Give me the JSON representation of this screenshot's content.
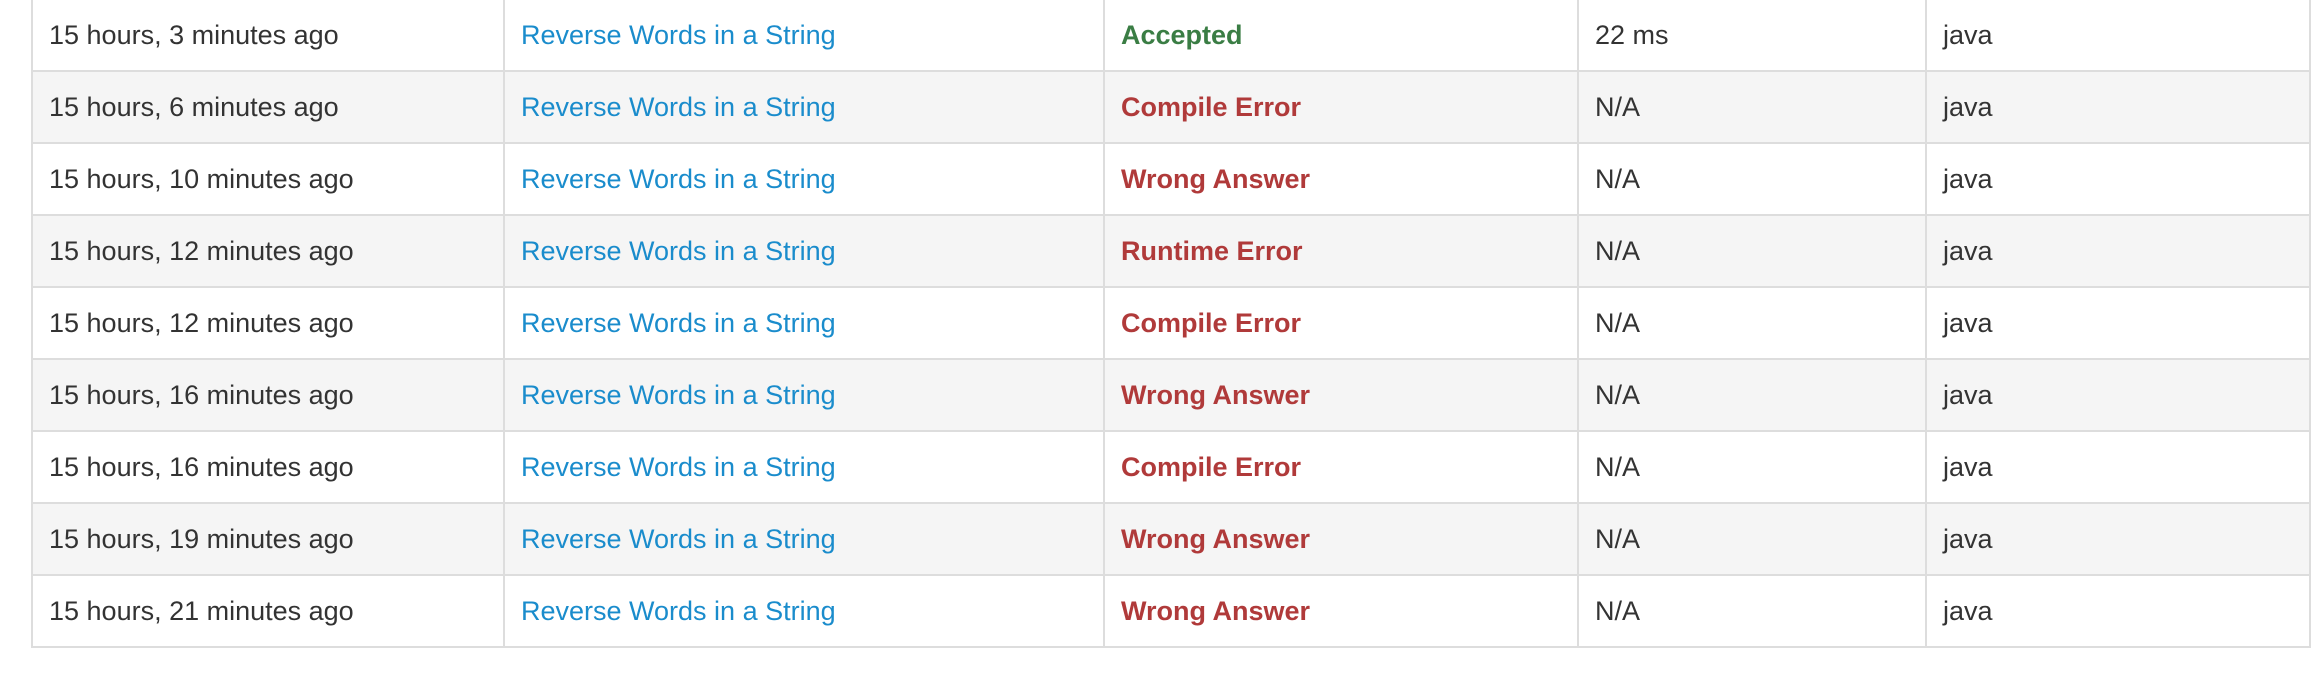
{
  "colors": {
    "link": "#1a8ccc",
    "accepted": "#3a7d44",
    "error": "#b03a3a",
    "border": "#dddddd",
    "stripe": "#f5f5f5"
  },
  "submissions": [
    {
      "time": "15 hours, 3 minutes ago",
      "problem": "Reverse Words in a String",
      "status": "Accepted",
      "status_kind": "accepted",
      "runtime": "22 ms",
      "language": "java"
    },
    {
      "time": "15 hours, 6 minutes ago",
      "problem": "Reverse Words in a String",
      "status": "Compile Error",
      "status_kind": "error",
      "runtime": "N/A",
      "language": "java"
    },
    {
      "time": "15 hours, 10 minutes ago",
      "problem": "Reverse Words in a String",
      "status": "Wrong Answer",
      "status_kind": "error",
      "runtime": "N/A",
      "language": "java"
    },
    {
      "time": "15 hours, 12 minutes ago",
      "problem": "Reverse Words in a String",
      "status": "Runtime Error",
      "status_kind": "error",
      "runtime": "N/A",
      "language": "java"
    },
    {
      "time": "15 hours, 12 minutes ago",
      "problem": "Reverse Words in a String",
      "status": "Compile Error",
      "status_kind": "error",
      "runtime": "N/A",
      "language": "java"
    },
    {
      "time": "15 hours, 16 minutes ago",
      "problem": "Reverse Words in a String",
      "status": "Wrong Answer",
      "status_kind": "error",
      "runtime": "N/A",
      "language": "java"
    },
    {
      "time": "15 hours, 16 minutes ago",
      "problem": "Reverse Words in a String",
      "status": "Compile Error",
      "status_kind": "error",
      "runtime": "N/A",
      "language": "java"
    },
    {
      "time": "15 hours, 19 minutes ago",
      "problem": "Reverse Words in a String",
      "status": "Wrong Answer",
      "status_kind": "error",
      "runtime": "N/A",
      "language": "java"
    },
    {
      "time": "15 hours, 21 minutes ago",
      "problem": "Reverse Words in a String",
      "status": "Wrong Answer",
      "status_kind": "error",
      "runtime": "N/A",
      "language": "java"
    }
  ]
}
